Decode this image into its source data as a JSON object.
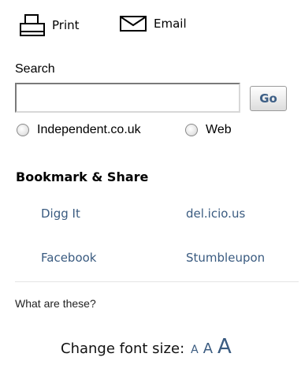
{
  "tools": {
    "print_label": "Print",
    "email_label": "Email"
  },
  "search": {
    "label": "Search",
    "value": "",
    "placeholder": "",
    "go_label": "Go",
    "scopes": [
      {
        "label": "Independent.co.uk",
        "selected": false
      },
      {
        "label": "Web",
        "selected": false
      }
    ]
  },
  "bookmark": {
    "heading": "Bookmark & Share",
    "links": [
      "Digg It",
      "del.icio.us",
      "Facebook",
      "Stumbleupon"
    ],
    "help_link": "What are these?"
  },
  "font_size": {
    "label": "Change font size:",
    "small": "A",
    "medium": "A",
    "large": "A"
  },
  "colors": {
    "link": "#3a5b80",
    "go_text": "#3d5f86"
  }
}
